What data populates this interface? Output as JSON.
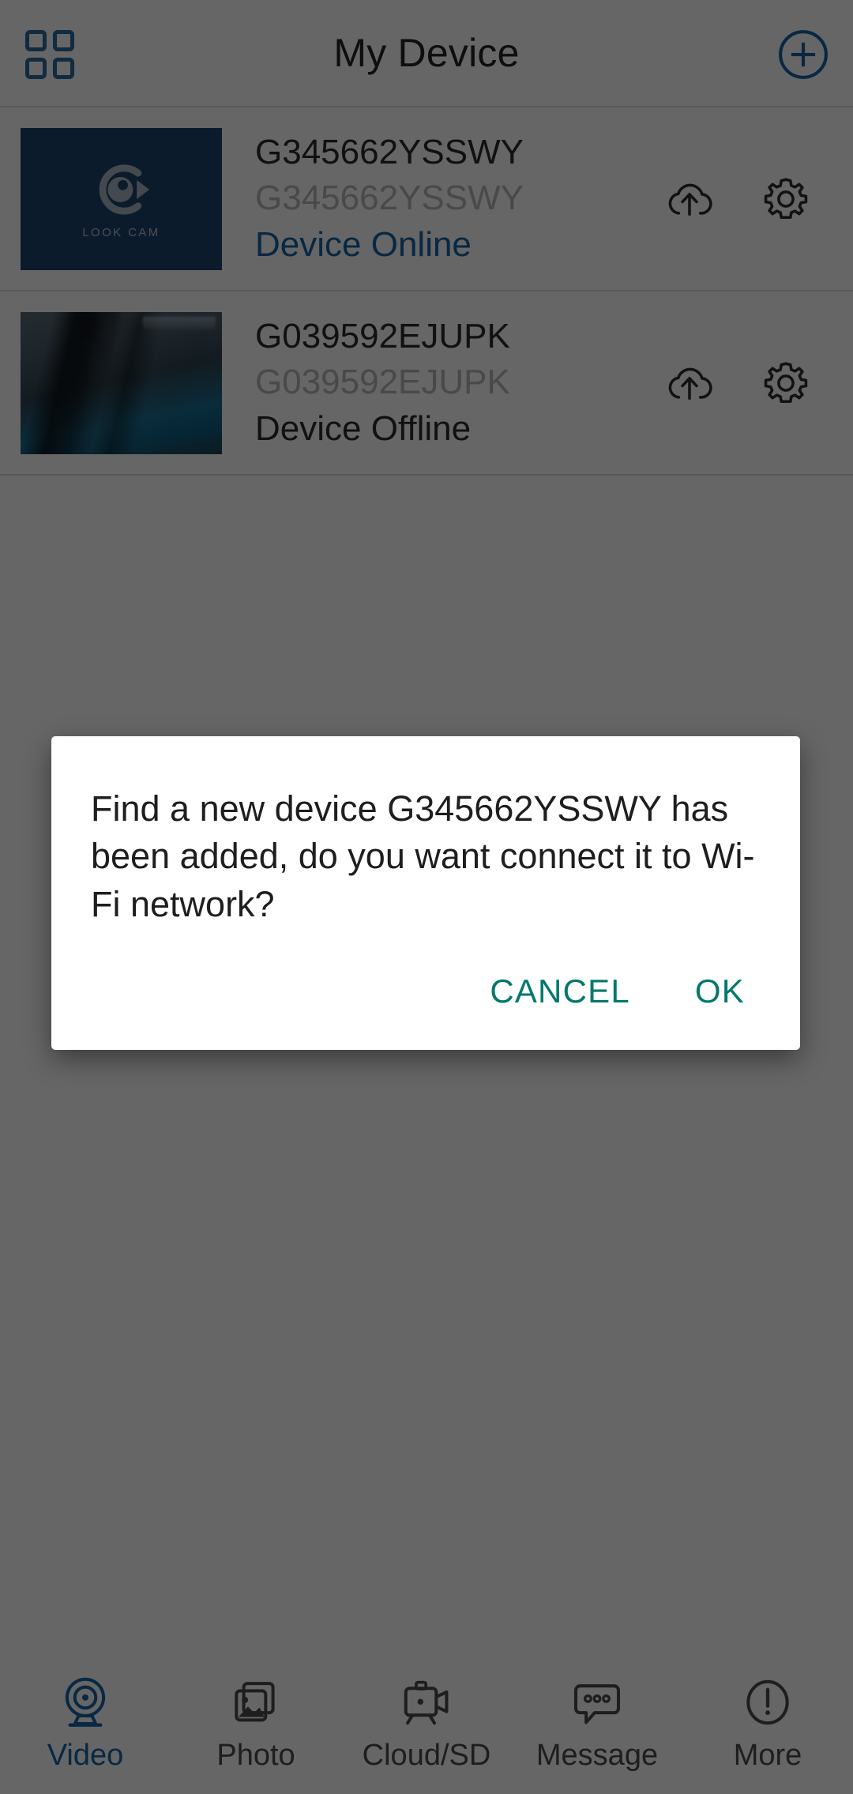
{
  "header": {
    "title": "My Device",
    "grid_icon": "grid-menu-icon",
    "add_icon": "plus-circle-icon"
  },
  "devices": [
    {
      "name": "G345662YSSWY",
      "id": "G345662YSSWY",
      "status": "Device Online",
      "status_state": "online",
      "thumbnail_kind": "logo",
      "thumbnail_logo_text": "LOOK CAM",
      "cloud_icon": "cloud-upload-icon",
      "settings_icon": "gear-icon"
    },
    {
      "name": "G039592EJUPK",
      "id": "G039592EJUPK",
      "status": "Device Offline",
      "status_state": "offline",
      "thumbnail_kind": "snapshot",
      "cloud_icon": "cloud-upload-icon",
      "settings_icon": "gear-icon"
    }
  ],
  "dialog": {
    "message": "Find a new device G345662YSSWY has been added, do you want connect it to Wi-Fi network?",
    "cancel_label": "CANCEL",
    "ok_label": "OK"
  },
  "tabbar": {
    "items": [
      {
        "label": "Video",
        "icon": "webcam-icon",
        "active": true
      },
      {
        "label": "Photo",
        "icon": "photos-icon",
        "active": false
      },
      {
        "label": "Cloud/SD",
        "icon": "camcorder-icon",
        "active": false
      },
      {
        "label": "Message",
        "icon": "chat-bubble-icon",
        "active": false
      },
      {
        "label": "More",
        "icon": "exclamation-circle-icon",
        "active": false
      }
    ]
  },
  "colors": {
    "accent_blue": "#1565a8",
    "dialog_action": "#00786b",
    "thumb_blue": "#1e456f",
    "text_primary": "#2c2c2c",
    "text_muted": "#b6b6b6",
    "scrim": "rgba(0,0,0,0.6)"
  }
}
